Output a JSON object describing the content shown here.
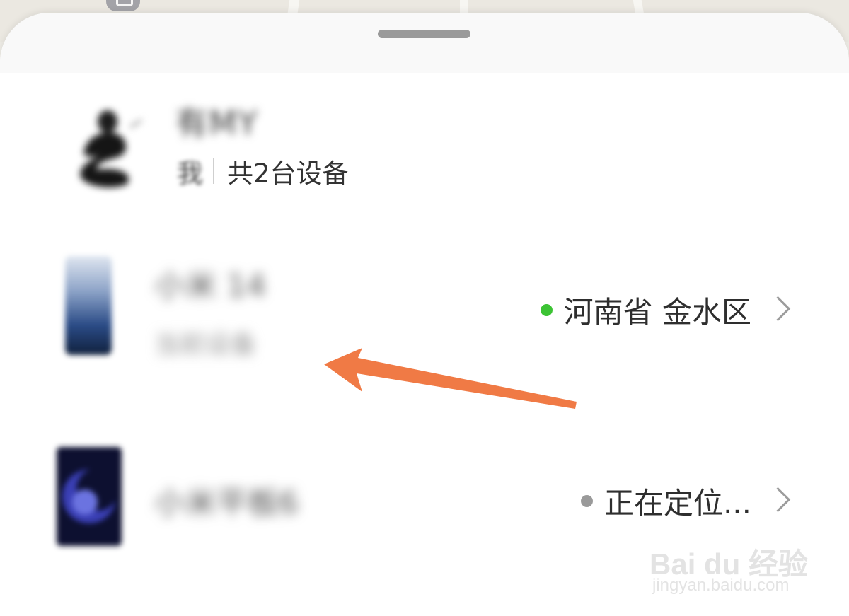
{
  "account": {
    "name": "有MY",
    "sub_left": "我",
    "device_count": "共2台设备"
  },
  "devices": [
    {
      "name": "小米 14",
      "desc": "当前设备",
      "status_label": "河南省 金水区",
      "status_color": "#3cc334"
    },
    {
      "name": "小米平板6",
      "desc": "",
      "status_label": "正在定位...",
      "status_color": "#9a9a9a"
    }
  ],
  "watermark": {
    "brand": "Bai du 经验",
    "url": "jingyan.baidu.com"
  },
  "colors": {
    "sheet": "#ffffff",
    "annotation_arrow": "#f07a45"
  }
}
